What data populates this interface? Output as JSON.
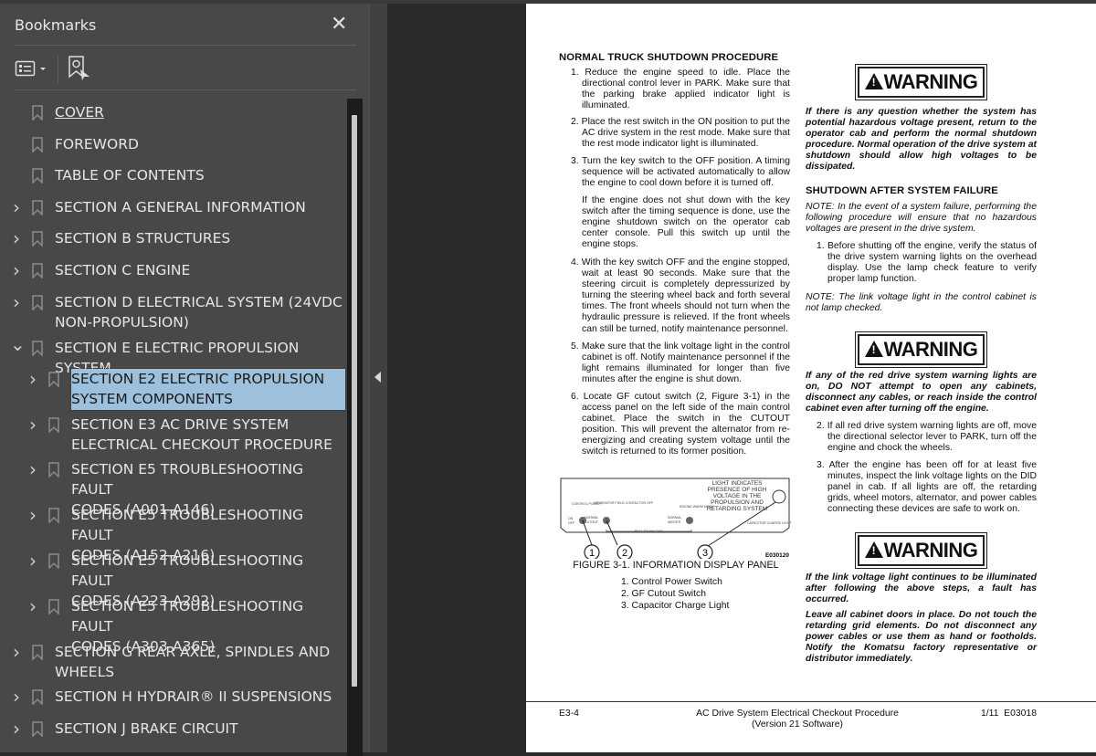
{
  "sidebar": {
    "title": "Bookmarks",
    "close_icon": "close-icon",
    "options_icon": "bookmark-options-icon",
    "find_icon": "find-current-bookmark-icon",
    "items": [
      {
        "label": "COVER",
        "level": 0,
        "expander": "none",
        "link": true
      },
      {
        "label": "FOREWORD",
        "level": 0,
        "expander": "none"
      },
      {
        "label": "TABLE OF CONTENTS",
        "level": 0,
        "expander": "none"
      },
      {
        "label": "SECTION A GENERAL INFORMATION",
        "level": 0,
        "expander": "collapsed"
      },
      {
        "label": "SECTION B STRUCTURES",
        "level": 0,
        "expander": "collapsed"
      },
      {
        "label": "SECTION C ENGINE",
        "level": 0,
        "expander": "collapsed"
      },
      {
        "label": "SECTION D ELECTRICAL SYSTEM (24VDC\nNON-PROPULSION)",
        "level": 0,
        "expander": "collapsed"
      },
      {
        "label": "SECTION E ELECTRIC PROPULSION SYSTEM",
        "level": 0,
        "expander": "expanded"
      },
      {
        "label": "SECTION E2 ELECTRIC PROPULSION\nSYSTEM COMPONENTS",
        "level": 1,
        "expander": "collapsed",
        "selected": true
      },
      {
        "label": "SECTION E3 AC DRIVE SYSTEM\nELECTRICAL CHECKOUT PROCEDURE",
        "level": 1,
        "expander": "collapsed"
      },
      {
        "label": "SECTION E5 TROUBLESHOOTING FAULT\nCODES (A001-A146)",
        "level": 1,
        "expander": "collapsed"
      },
      {
        "label": "SECTION E5 TROUBLESHOOTING FAULT\nCODES (A152-A216)",
        "level": 1,
        "expander": "collapsed"
      },
      {
        "label": "SECTION E5 TROUBLESHOOTING FAULT\nCODES (A223-A292)",
        "level": 1,
        "expander": "collapsed"
      },
      {
        "label": "SECTION E5 TROUBLESHOOTING FAULT\nCODES (A303-A365)",
        "level": 1,
        "expander": "collapsed"
      },
      {
        "label": "SECTION G REAR AXLE, SPINDLES AND\nWHEELS",
        "level": 0,
        "expander": "collapsed"
      },
      {
        "label": "SECTION H HYDRAIR® II SUSPENSIONS",
        "level": 0,
        "expander": "collapsed"
      },
      {
        "label": "SECTION J BRAKE CIRCUIT",
        "level": 0,
        "expander": "collapsed"
      }
    ],
    "selected_color": "#9dc1dc"
  },
  "document": {
    "left": {
      "heading": "NORMAL TRUCK SHUTDOWN PROCEDURE",
      "items": [
        "1. Reduce the engine speed to idle. Place the directional control lever in PARK. Make sure that the parking brake applied indicator light is illuminated.",
        "2. Place the rest switch in the ON position to put the AC drive system in the rest mode. Make sure that the rest mode indicator light is illuminated.",
        "3. Turn the key switch to the OFF position. A timing sequence will be activated automatically to allow the engine to cool down before it is turned off.",
        "If the engine does not shut down with the key switch after the timing sequence is done, use the engine shutdown switch on the operator cab center console. Pull this switch up until the engine stops.",
        "4. With the key switch OFF and the engine stopped, wait at least 90 seconds. Make sure that the steering circuit is completely depressurized by turning the steering wheel back and forth several times. The front wheels should not turn when the hydraulic pressure is relieved. If the front wheels can still be turned, notify maintenance personnel.",
        "5. Make sure that the link voltage light in the control cabinet is off. Notify maintenance personnel if the light remains illuminated for longer than five minutes after the engine is shut down.",
        "6. Locate GF cutout switch (2, Figure 3-1) in the access panel on the left side of the main control cabinet. Place the switch in the CUTOUT position. This will prevent the alternator from re-energizing and creating system voltage until the switch is returned to its former position."
      ],
      "figure": {
        "labels": {
          "control_power": "CONTROL POWER",
          "on": "ON",
          "off": "OFF",
          "normal": "NORMAL",
          "cutout": "CUTOUT",
          "gen_field": "GENERATOR FIELD CONTACTOR OFF",
          "engine": "ENGINE WARM MODE",
          "normal2": "NORMAL",
          "winter": "WINTER",
          "pull": "PULL TO UNLOCK",
          "light_note": "LIGHT INDICATES PRESENCE OF HIGH VOLTAGE IN THE PROPULSION AND RETARDING SYSTEM",
          "cap_light": "CAPACITOR CHARGE LIGHT"
        },
        "callouts": [
          "1",
          "2",
          "3"
        ],
        "code": "E030120",
        "caption": "FIGURE 3-1. INFORMATION DISPLAY PANEL",
        "legend": [
          "1. Control Power Switch",
          "2. GF Cutout Switch",
          "3. Capacitor Charge Light"
        ]
      }
    },
    "right": {
      "warning_label": "WARNING",
      "warning1": "If there is any question whether the system has potential hazardous voltage present, return to the operator cab and perform the normal shutdown procedure. Normal operation of the drive system at shutdown should allow high voltages to be dissipated.",
      "heading": "SHUTDOWN AFTER SYSTEM FAILURE",
      "note1": "NOTE: In the event of a system failure, performing the following procedure will ensure that no hazardous voltages are present in the drive system.",
      "item1": "1. Before shutting off the engine, verify the status of the drive system warning lights on the overhead display. Use the lamp check feature to verify proper lamp function.",
      "note2": "NOTE: The link voltage light in the control cabinet is not lamp checked.",
      "warning2": "If any of the red drive system warning lights are on, DO NOT attempt to open any cabinets, disconnect any cables, or reach inside the control cabinet even after turning off the engine.",
      "item2": "2. If all red drive system warning lights are off, move the directional selector lever to PARK, turn off the engine and chock the wheels.",
      "item3": "3. After the engine has been off for at least five minutes, inspect the link voltage lights on the DID panel in cab. If all lights are off, the retarding grids, wheel motors, alternator, and power cables connecting these devices are safe to work on.",
      "warning3a": "If the link voltage light continues to be illuminated after following the above steps, a fault has occurred.",
      "warning3b": "Leave all cabinet doors in place. Do not touch the retarding grid elements. Do not disconnect any power cables or use them as hand or footholds. Notify the Komatsu factory representative or distributor immediately."
    },
    "footer": {
      "page": "E3-4",
      "title": "AC Drive System Electrical Checkout Procedure",
      "subtitle": "(Version 21 Software)",
      "code": "1/11  E03018"
    }
  }
}
